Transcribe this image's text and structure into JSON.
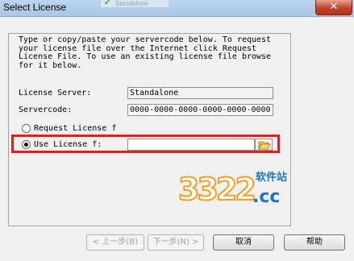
{
  "window": {
    "title": "Select License",
    "ghost_tab_label": "Standalone",
    "close_symbol": "✕"
  },
  "body": {
    "description": "Type or copy/paste your servercode below. To request\nyour license file over the Internet click Request\nLicense File. To use an existing license file browse\nfor it below."
  },
  "fields": {
    "license_server_label": "License Server:",
    "license_server_value": "Standalone",
    "servercode_label": "Servercode:",
    "servercode_value": "0000-0000-0000-0000-0000-0000"
  },
  "options": {
    "request_label": "Request License f",
    "use_label": "Use License f:",
    "license_path_value": ""
  },
  "buttons": {
    "back": "< 上一步(B)",
    "next": "下一步(N) >",
    "cancel": "取消",
    "help": "帮助"
  },
  "watermark": {
    "digits": "3322",
    "domain": ".cc",
    "chinese": "软件站"
  },
  "icons": {
    "browse": "folder-open-icon",
    "close": "close-icon"
  },
  "colors": {
    "highlight": "#e02020",
    "title_bar": "#bcd6ee",
    "close_button": "#c4422b"
  }
}
